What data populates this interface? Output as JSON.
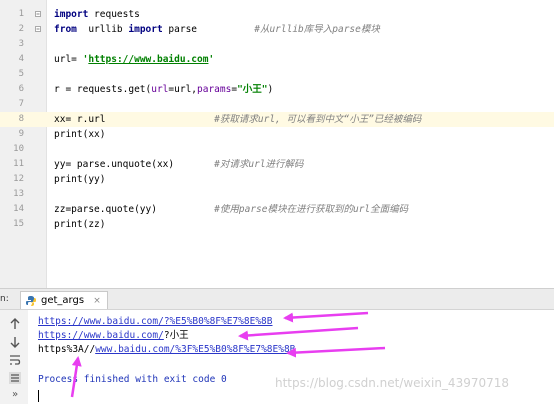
{
  "editor": {
    "lines": [
      {
        "n": "1",
        "segs": [
          {
            "t": "import",
            "c": "kw"
          },
          {
            "t": " requests",
            "c": ""
          }
        ]
      },
      {
        "n": "2",
        "segs": [
          {
            "t": "from",
            "c": "kw"
          },
          {
            "t": "  urllib ",
            "c": ""
          },
          {
            "t": "import",
            "c": "kw"
          },
          {
            "t": " parse          ",
            "c": ""
          },
          {
            "t": "#从urllib库导入parse模块",
            "c": "cm"
          }
        ]
      },
      {
        "n": "3",
        "segs": []
      },
      {
        "n": "4",
        "segs": [
          {
            "t": "url= ",
            "c": ""
          },
          {
            "t": "'",
            "c": "str"
          },
          {
            "t": "https://www.baidu.com",
            "c": "url"
          },
          {
            "t": "'",
            "c": "str"
          }
        ]
      },
      {
        "n": "5",
        "segs": []
      },
      {
        "n": "6",
        "segs": [
          {
            "t": "r = requests.get(",
            "c": ""
          },
          {
            "t": "url",
            "c": "prm"
          },
          {
            "t": "=url,",
            "c": ""
          },
          {
            "t": "params",
            "c": "prm"
          },
          {
            "t": "=",
            "c": ""
          },
          {
            "t": "\"小王\"",
            "c": "str"
          },
          {
            "t": ")",
            "c": ""
          }
        ]
      },
      {
        "n": "7",
        "segs": []
      },
      {
        "n": "8",
        "segs": [
          {
            "t": "xx= r.url                   ",
            "c": ""
          },
          {
            "t": "#获取请求url, 可以看到中文“小王”已经被编码",
            "c": "cm"
          }
        ]
      },
      {
        "n": "9",
        "segs": [
          {
            "t": "print(xx)",
            "c": ""
          }
        ]
      },
      {
        "n": "10",
        "segs": []
      },
      {
        "n": "11",
        "segs": [
          {
            "t": "yy= parse.unquote(xx)       ",
            "c": ""
          },
          {
            "t": "#对请求url进行解码",
            "c": "cm"
          }
        ]
      },
      {
        "n": "12",
        "segs": [
          {
            "t": "print(yy)",
            "c": ""
          }
        ]
      },
      {
        "n": "13",
        "segs": []
      },
      {
        "n": "14",
        "segs": [
          {
            "t": "zz=parse.quote(yy)          ",
            "c": ""
          },
          {
            "t": "#使用parse模块在进行获取到的url全面编码",
            "c": "cm"
          }
        ]
      },
      {
        "n": "15",
        "segs": [
          {
            "t": "print(zz)",
            "c": ""
          }
        ]
      }
    ],
    "current_line": "8"
  },
  "run_panel": {
    "label": "n:",
    "tab_name": "get_args",
    "tab_close": "×"
  },
  "console": {
    "lines": [
      [
        {
          "t": "https://www.baidu.com/?%E5%B0%8F%E7%8E%8B",
          "c": "link"
        }
      ],
      [
        {
          "t": "https://www.baidu.com/",
          "c": "link"
        },
        {
          "t": "?小王",
          "c": ""
        }
      ],
      [
        {
          "t": "https%3A//",
          "c": ""
        },
        {
          "t": "www.baidu.com/%3F%E5%B0%8F%E7%8E%8B",
          "c": "link"
        }
      ],
      [],
      [
        {
          "t": "Process finished with exit code 0",
          "c": "exit"
        }
      ]
    ]
  },
  "watermark": "https://blog.csdn.net/weixin_43970718",
  "colors": {
    "arrow": "#e83ef0",
    "keyword": "#000080",
    "string": "#008000",
    "comment": "#808080",
    "link": "#2a36c9"
  }
}
